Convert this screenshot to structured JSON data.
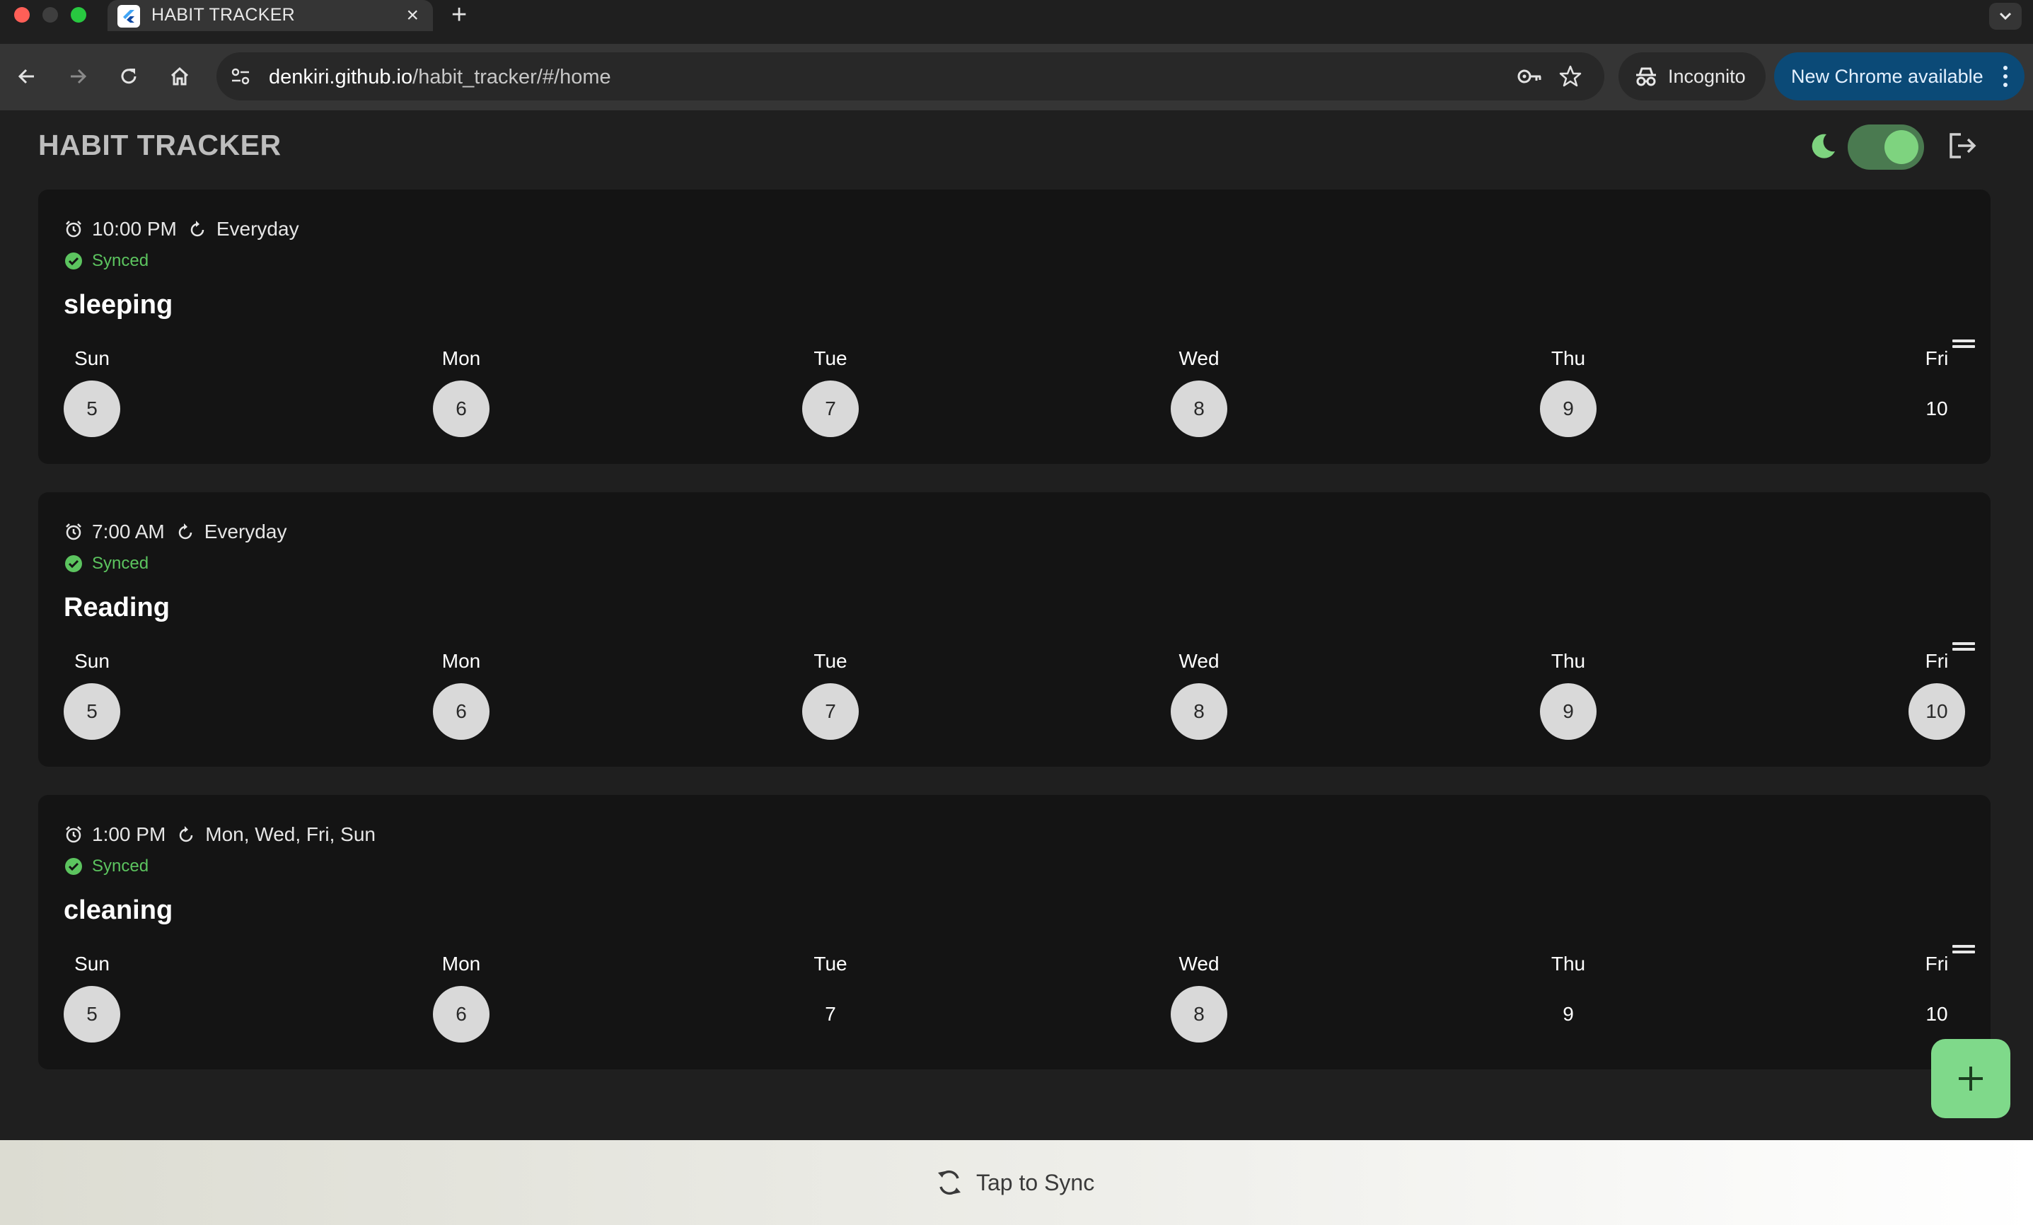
{
  "browser": {
    "tab_title": "HABIT TRACKER",
    "url_host": "denkiri.github.io",
    "url_path": "/habit_tracker/#/home",
    "incognito_label": "Incognito",
    "update_label": "New Chrome available"
  },
  "app": {
    "title": "HABIT TRACKER",
    "dark_mode": true
  },
  "habits": [
    {
      "time": "10:00 PM",
      "repeat": "Everyday",
      "status": "Synced",
      "name": "sleeping",
      "days": [
        {
          "name": "Sun",
          "num": "5",
          "done": true
        },
        {
          "name": "Mon",
          "num": "6",
          "done": true
        },
        {
          "name": "Tue",
          "num": "7",
          "done": true
        },
        {
          "name": "Wed",
          "num": "8",
          "done": true
        },
        {
          "name": "Thu",
          "num": "9",
          "done": true
        },
        {
          "name": "Fri",
          "num": "10",
          "done": false
        }
      ]
    },
    {
      "time": "7:00 AM",
      "repeat": "Everyday",
      "status": "Synced",
      "name": "Reading",
      "days": [
        {
          "name": "Sun",
          "num": "5",
          "done": true
        },
        {
          "name": "Mon",
          "num": "6",
          "done": true
        },
        {
          "name": "Tue",
          "num": "7",
          "done": true
        },
        {
          "name": "Wed",
          "num": "8",
          "done": true
        },
        {
          "name": "Thu",
          "num": "9",
          "done": true
        },
        {
          "name": "Fri",
          "num": "10",
          "done": true
        }
      ]
    },
    {
      "time": "1:00 PM",
      "repeat": "Mon, Wed, Fri, Sun",
      "status": "Synced",
      "name": "cleaning",
      "days": [
        {
          "name": "Sun",
          "num": "5",
          "done": true
        },
        {
          "name": "Mon",
          "num": "6",
          "done": true
        },
        {
          "name": "Tue",
          "num": "7",
          "done": false
        },
        {
          "name": "Wed",
          "num": "8",
          "done": true
        },
        {
          "name": "Thu",
          "num": "9",
          "done": false
        },
        {
          "name": "Fri",
          "num": "10",
          "done": false
        }
      ]
    }
  ],
  "sync_bar": {
    "label": "Tap to Sync"
  },
  "colors": {
    "accent": "#7fd98a",
    "synced": "#5cc45f",
    "card": "#141414",
    "background": "#1f1f1f"
  }
}
